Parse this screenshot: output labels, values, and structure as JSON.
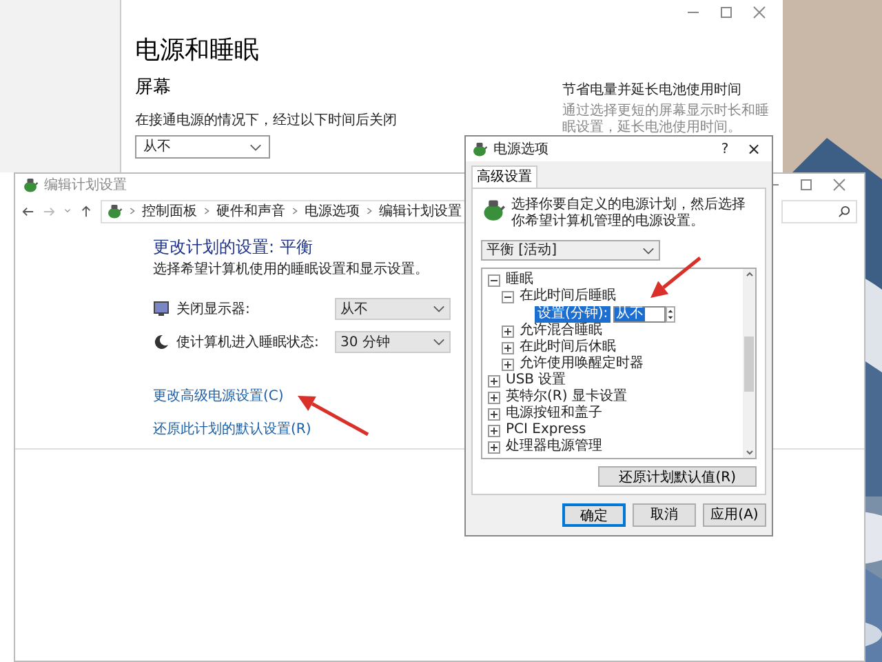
{
  "settings_window": {
    "title": "电源和睡眠",
    "section": "屏幕",
    "field_label": "在接通电源的情况下，经过以下时间后关闭",
    "dropdown": "从不",
    "side_title": "节省电量并延长电池使用时间",
    "side_text": "通过选择更短的屏幕显示时长和睡眠设置，延长电池使用时间。"
  },
  "plan_window": {
    "title": "编辑计划设置",
    "breadcrumb": [
      "控制面板",
      "硬件和声音",
      "电源选项",
      "编辑计划设置"
    ],
    "heading": "更改计划的设置: 平衡",
    "subtitle": "选择希望计算机使用的睡眠设置和显示设置。",
    "settings": [
      {
        "kind": "display",
        "label": "关闭显示器:",
        "value": "从不"
      },
      {
        "kind": "sleep",
        "label": "使计算机进入睡眠状态:",
        "value": "30 分钟"
      }
    ],
    "links": [
      "更改高级电源设置(C)",
      "还原此计划的默认设置(R)"
    ]
  },
  "dialog": {
    "title": "电源选项",
    "help": "?",
    "close": "×",
    "tab": "高级设置",
    "description": "选择你要自定义的电源计划，然后选择你希望计算机管理的电源设置。",
    "plan": "平衡 [活动]",
    "tree": [
      {
        "label": "睡眠",
        "expanded": true,
        "children": [
          {
            "label": "在此时间后睡眠",
            "expanded": true,
            "setting_label": "设置(分钟):",
            "setting_value": "从不"
          },
          {
            "label": "允许混合睡眠",
            "expanded": false
          },
          {
            "label": "在此时间后休眠",
            "expanded": false
          },
          {
            "label": "允许使用唤醒定时器",
            "expanded": false
          }
        ]
      },
      {
        "label": "USB 设置",
        "expanded": false
      },
      {
        "label": "英特尔(R) 显卡设置",
        "expanded": false
      },
      {
        "label": "电源按钮和盖子",
        "expanded": false
      },
      {
        "label": "PCI Express",
        "expanded": false
      },
      {
        "label": "处理器电源管理",
        "expanded": false
      }
    ],
    "restore_button": "还原计划默认值(R)",
    "buttons": [
      {
        "label": "确定",
        "selected": true
      },
      {
        "label": "取消",
        "selected": false
      },
      {
        "label": "应用(A)",
        "selected": false
      }
    ]
  }
}
